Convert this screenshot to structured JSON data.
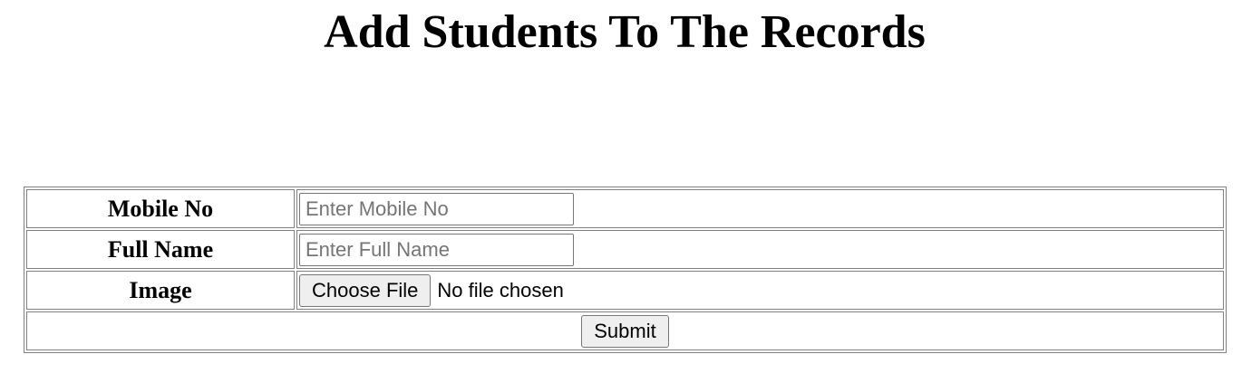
{
  "page": {
    "title": "Add Students To The Records"
  },
  "form": {
    "mobile": {
      "label": "Mobile No",
      "value": "",
      "placeholder": "Enter Mobile No"
    },
    "full_name": {
      "label": "Full Name",
      "value": "",
      "placeholder": "Enter Full Name"
    },
    "image": {
      "label": "Image",
      "button_label": "Choose File",
      "status": "No file chosen"
    },
    "submit_label": "Submit"
  },
  "colors": {
    "text": "#000000",
    "background": "#ffffff",
    "border": "#808080",
    "button_bg": "#efefef",
    "placeholder": "#757575"
  }
}
